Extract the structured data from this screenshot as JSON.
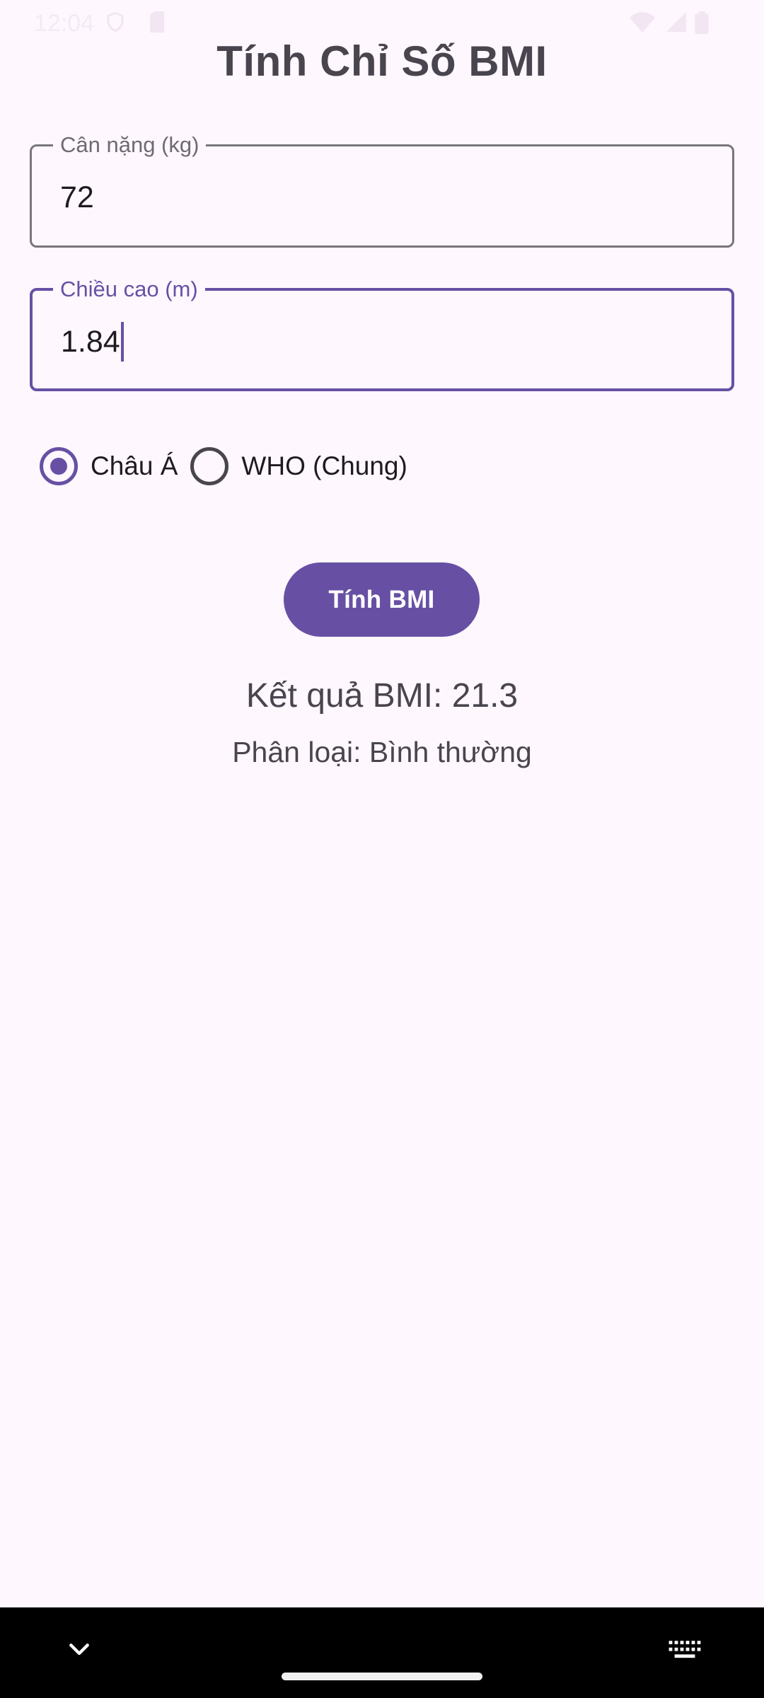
{
  "status_bar": {
    "time": "12:04",
    "icons": [
      "shield-icon",
      "sim-icon",
      "wifi-icon",
      "signal-icon",
      "battery-icon"
    ]
  },
  "title": "Tính Chỉ Số BMI",
  "weight_field": {
    "label": "Cân nặng (kg)",
    "value": "72"
  },
  "height_field": {
    "label": "Chiều cao (m)",
    "value": "1.84"
  },
  "standard": {
    "options": [
      {
        "label": "Châu Á",
        "selected": true
      },
      {
        "label": "WHO (Chung)",
        "selected": false
      }
    ]
  },
  "button": {
    "label": "Tính BMI"
  },
  "result": {
    "bmi_text": "Kết quả BMI: 21.3",
    "classification_text": "Phân loại: Bình thường"
  },
  "nav_bar": {
    "icons": [
      "chevron-down-icon",
      "keyboard-icon"
    ]
  },
  "colors": {
    "primary": "#6750A4",
    "background": "#FFF7FE",
    "outline": "#79747E",
    "text": "#49454F"
  }
}
